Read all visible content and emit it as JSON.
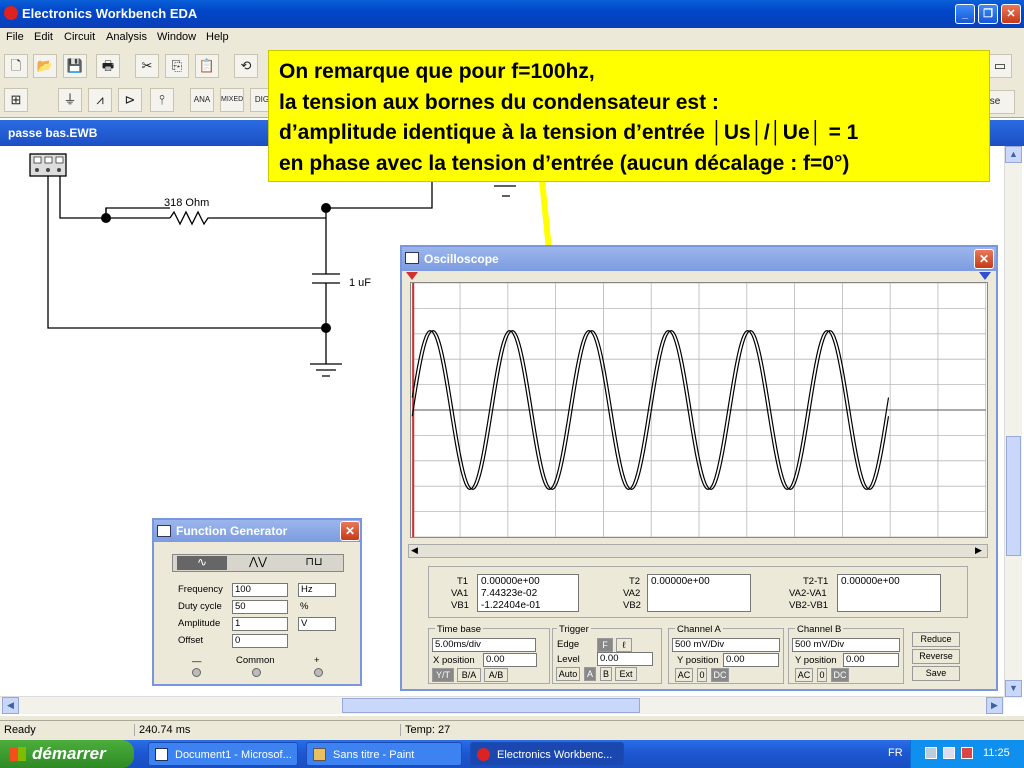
{
  "app": {
    "title": "Electronics Workbench EDA"
  },
  "menu": [
    "File",
    "Edit",
    "Circuit",
    "Analysis",
    "Window",
    "Help"
  ],
  "toolbar": {
    "sample_label": "se",
    "parts": [
      "ANA",
      "MIXED",
      "DIG"
    ]
  },
  "document": {
    "title": "passe bas.EWB"
  },
  "circuit": {
    "resistor_label": "318  Ohm",
    "capacitor_label": "1 uF"
  },
  "callout": {
    "line1": "On remarque que pour f=100hz,",
    "line2": "la tension aux bornes du condensateur est :",
    "line3": "d’amplitude identique à la tension d’entrée │Us│/│Ue│ = 1",
    "line4": "en phase avec la tension d’entrée (aucun décalage :  f=0°)"
  },
  "oscilloscope": {
    "title": "Oscilloscope",
    "t1_label": "T1",
    "va1_label": "VA1",
    "vb1_label": "VB1",
    "t1": "0.00000e+00",
    "va1": "7.44323e-02",
    "vb1": "-1.22404e-01",
    "t2_label": "T2",
    "va2_label": "VA2",
    "vb2_label": "VB2",
    "t2": "0.00000e+00",
    "t2t1_label": "T2-T1",
    "va2va1_label": "VA2-VA1",
    "vb2vb1_label": "VB2-VB1",
    "t2t1": "0.00000e+00",
    "timebase_label": "Time base",
    "timebase_value": "5.00ms/div",
    "xpos_label": "X position",
    "xpos_value": "0.00",
    "mode_yt": "Y/T",
    "mode_ba": "B/A",
    "mode_ab": "A/B",
    "trigger_label": "Trigger",
    "edge_label": "Edge",
    "level_label": "Level",
    "level_value": "0.00",
    "trig_auto": "Auto",
    "trig_a": "A",
    "trig_b": "B",
    "trig_ext": "Ext",
    "chA_label": "Channel A",
    "chA_value": "500 mV/Div",
    "chA_ypos_label": "Y position",
    "chA_ypos": "0.00",
    "chB_label": "Channel B",
    "chB_value": "500 mV/Div",
    "chB_ypos_label": "Y position",
    "chB_ypos": "0.00",
    "ac": "AC",
    "zero": "0",
    "dc": "DC",
    "reduce": "Reduce",
    "reverse": "Reverse",
    "save": "Save"
  },
  "function_generator": {
    "title": "Function Generator",
    "frequency_label": "Frequency",
    "frequency_value": "100",
    "frequency_unit": "Hz",
    "duty_label": "Duty cycle",
    "duty_value": "50",
    "duty_unit": "%",
    "amplitude_label": "Amplitude",
    "amplitude_value": "1",
    "amplitude_unit": "V",
    "offset_label": "Offset",
    "offset_value": "0",
    "minus": "—",
    "common": "Common",
    "plus": "+"
  },
  "status": {
    "ready": "Ready",
    "time": "240.74 ms",
    "temp": "Temp:  27"
  },
  "taskbar": {
    "start": "démarrer",
    "tasks": [
      "Document1 - Microsof...",
      "Sans titre - Paint",
      "Electronics Workbenc..."
    ],
    "lang": "FR",
    "clock": "11:25"
  },
  "colors": {
    "callout": "#ffff00",
    "arrow": "#ffff00",
    "title_blue": "#0046c8"
  }
}
